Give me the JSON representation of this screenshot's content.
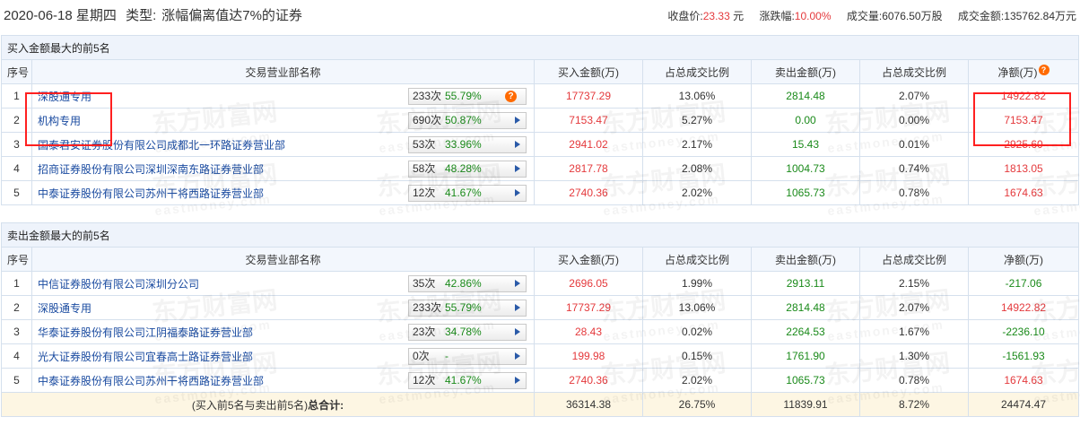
{
  "header": {
    "date": "2020-06-18 星期四",
    "type_label": "类型:",
    "type_value": "涨幅偏离值达7%的证券",
    "close_label": "收盘价:",
    "close_value": "23.33",
    "close_unit": "元",
    "change_label": "涨跌幅:",
    "change_value": "10.00%",
    "volume_label": "成交量:",
    "volume_value": "6076.50万股",
    "amount_label": "成交金额:",
    "amount_value": "135762.84万元"
  },
  "columns": {
    "no": "序号",
    "name": "交易营业部名称",
    "buy": "买入金额(万)",
    "buy_ratio": "占总成交比例",
    "sell": "卖出金额(万)",
    "sell_ratio": "占总成交比例",
    "net": "净额(万)"
  },
  "watermark": {
    "cn": "东方财富网",
    "en": "eastmoney.com"
  },
  "buy_section": {
    "title": "买入金额最大的前5名",
    "rows": [
      {
        "no": "1",
        "name": "深股通专用",
        "count": "233次",
        "pct": "55.79%",
        "buy": "17737.29",
        "buy_ratio": "13.06%",
        "sell": "2814.48",
        "sell_ratio": "2.07%",
        "net": "14922.82"
      },
      {
        "no": "2",
        "name": "机构专用",
        "count": "690次",
        "pct": "50.87%",
        "buy": "7153.47",
        "buy_ratio": "5.27%",
        "sell": "0.00",
        "sell_ratio": "0.00%",
        "net": "7153.47"
      },
      {
        "no": "3",
        "name": "国泰君安证券股份有限公司成都北一环路证券营业部",
        "count": "53次",
        "pct": "33.96%",
        "buy": "2941.02",
        "buy_ratio": "2.17%",
        "sell": "15.43",
        "sell_ratio": "0.01%",
        "net": "2925.60"
      },
      {
        "no": "4",
        "name": "招商证券股份有限公司深圳深南东路证券营业部",
        "count": "58次",
        "pct": "48.28%",
        "buy": "2817.78",
        "buy_ratio": "2.08%",
        "sell": "1004.73",
        "sell_ratio": "0.74%",
        "net": "1813.05"
      },
      {
        "no": "5",
        "name": "中泰证券股份有限公司苏州干将西路证券营业部",
        "count": "12次",
        "pct": "41.67%",
        "buy": "2740.36",
        "buy_ratio": "2.02%",
        "sell": "1065.73",
        "sell_ratio": "0.78%",
        "net": "1674.63"
      }
    ]
  },
  "sell_section": {
    "title": "卖出金额最大的前5名",
    "rows": [
      {
        "no": "1",
        "name": "中信证券股份有限公司深圳分公司",
        "count": "35次",
        "pct": "42.86%",
        "buy": "2696.05",
        "buy_ratio": "1.99%",
        "sell": "2913.11",
        "sell_ratio": "2.15%",
        "net": "-217.06"
      },
      {
        "no": "2",
        "name": "深股通专用",
        "count": "233次",
        "pct": "55.79%",
        "buy": "17737.29",
        "buy_ratio": "13.06%",
        "sell": "2814.48",
        "sell_ratio": "2.07%",
        "net": "14922.82"
      },
      {
        "no": "3",
        "name": "华泰证券股份有限公司江阴福泰路证券营业部",
        "count": "23次",
        "pct": "34.78%",
        "buy": "28.43",
        "buy_ratio": "0.02%",
        "sell": "2264.53",
        "sell_ratio": "1.67%",
        "net": "-2236.10"
      },
      {
        "no": "4",
        "name": "光大证券股份有限公司宜春高士路证券营业部",
        "count": "0次",
        "pct": "-",
        "buy": "199.98",
        "buy_ratio": "0.15%",
        "sell": "1761.90",
        "sell_ratio": "1.30%",
        "net": "-1561.93"
      },
      {
        "no": "5",
        "name": "中泰证券股份有限公司苏州干将西路证券营业部",
        "count": "12次",
        "pct": "41.67%",
        "buy": "2740.36",
        "buy_ratio": "2.02%",
        "sell": "1065.73",
        "sell_ratio": "0.78%",
        "net": "1674.63"
      }
    ]
  },
  "total": {
    "label_prefix": "(买入前5名与卖出前5名)",
    "label_bold": "总合计:",
    "buy": "36314.38",
    "buy_ratio": "26.75%",
    "sell": "11839.91",
    "sell_ratio": "8.72%",
    "net": "24474.47"
  }
}
